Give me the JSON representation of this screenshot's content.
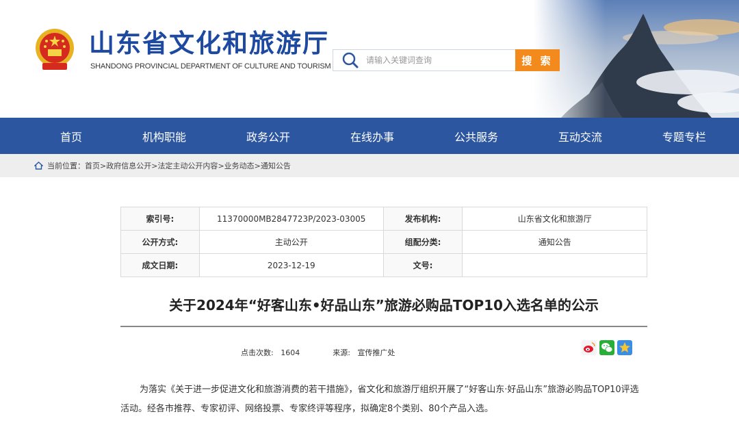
{
  "header": {
    "title": "山东省文化和旅游厅",
    "subtitle": "SHANDONG PROVINCIAL DEPARTMENT OF CULTURE AND TOURISM",
    "search": {
      "placeholder": "请输入关键词查询",
      "button_label": "搜 索"
    }
  },
  "nav": {
    "items": [
      {
        "label": "首页"
      },
      {
        "label": "机构职能"
      },
      {
        "label": "政务公开"
      },
      {
        "label": "在线办事"
      },
      {
        "label": "公共服务"
      },
      {
        "label": "互动交流"
      },
      {
        "label": "专题专栏"
      }
    ]
  },
  "breadcrumb": {
    "prefix": "当前位置：",
    "items": [
      "首页",
      "政府信息公开",
      "法定主动公开内容",
      "业务动态",
      "通知公告"
    ],
    "sep": ">"
  },
  "info_table": {
    "rows": [
      {
        "l1": "索引号:",
        "v1": "11370000MB2847723P/2023-03005",
        "l2": "发布机构:",
        "v2": "山东省文化和旅游厅"
      },
      {
        "l1": "公开方式:",
        "v1": "主动公开",
        "l2": "组配分类:",
        "v2": "通知公告"
      },
      {
        "l1": "成文日期:",
        "v1": "2023-12-19",
        "l2": "文号:",
        "v2": ""
      }
    ]
  },
  "article": {
    "title": "关于2024年“好客山东•好品山东”旅游必购品TOP10入选名单的公示",
    "views_label": "点击次数:",
    "views_value": "1604",
    "source_label": "来源:",
    "source_value": "宣传推广处",
    "body": "为落实《关于进一步促进文化和旅游消费的若干措施》，省文化和旅游厅组织开展了“好客山东·好品山东”旅游必购品TOP10评选活动。经各市推荐、专家初评、网络投票、专家终评等程序，拟确定8个类别、80个产品入选。"
  },
  "share": {
    "icons": [
      "weibo-icon",
      "wechat-icon",
      "qzone-icon"
    ]
  },
  "colors": {
    "brand_blue": "#1d4aa0",
    "nav_bg": "#2c56a0",
    "search_button": "#f28a1e",
    "breadcrumb_bg": "#eeeeee"
  }
}
